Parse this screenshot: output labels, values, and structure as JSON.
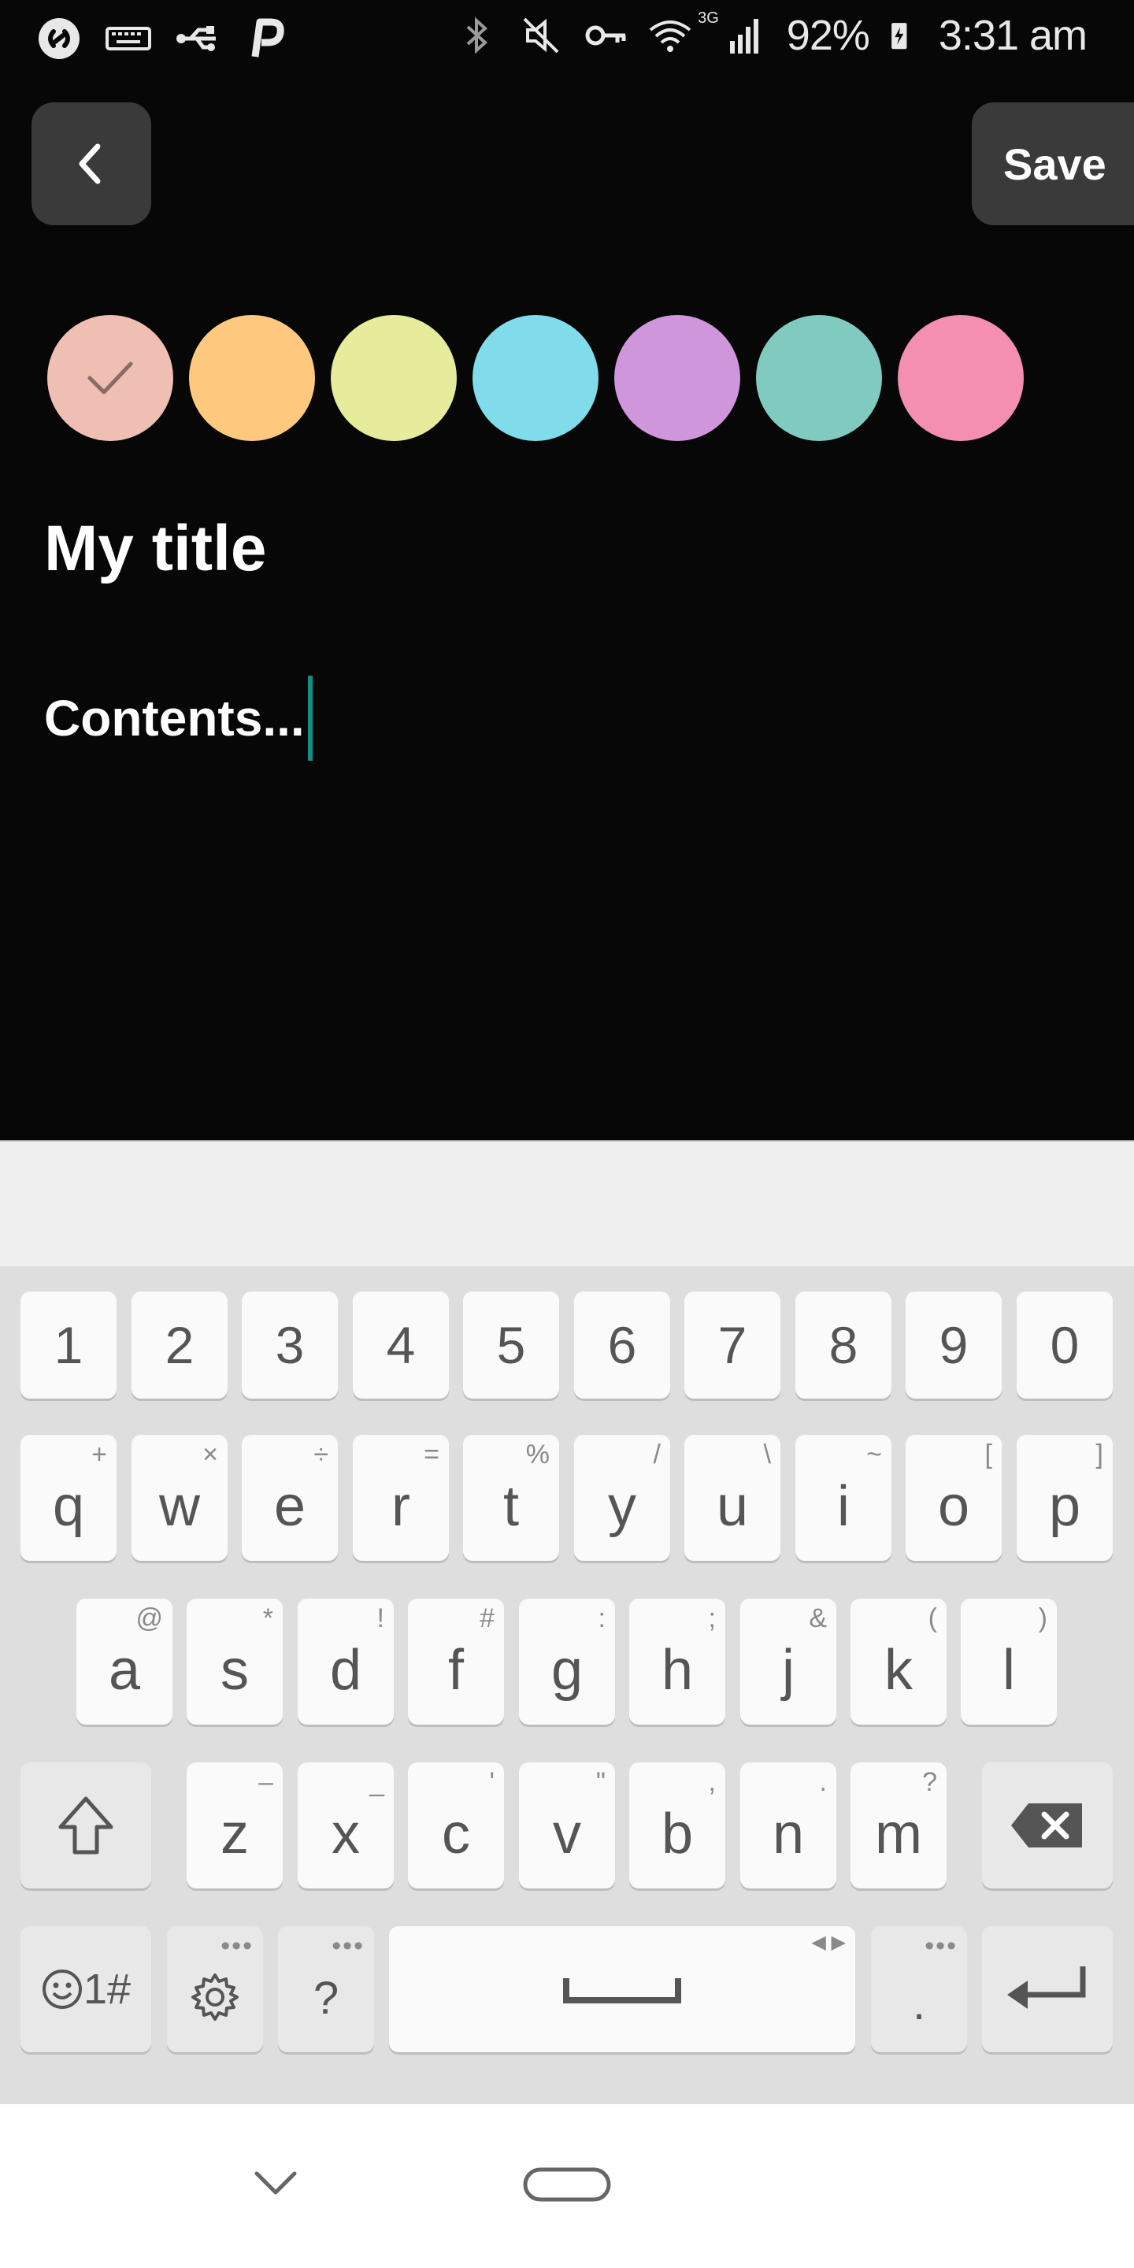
{
  "status_bar": {
    "battery_percent": "92%",
    "time": "3:31 am",
    "network": "3G",
    "icons": [
      "shazam-icon",
      "keyboard-icon",
      "usb-icon",
      "parking-icon",
      "bluetooth-icon",
      "mute-icon",
      "vpn-key-icon",
      "wifi-icon",
      "signal-icon",
      "battery-charging-icon"
    ]
  },
  "toolbar": {
    "back_icon": "chevron-left-icon",
    "save_label": "Save"
  },
  "colors": {
    "selected": "#f0bfb3",
    "swatches": [
      "#f0bfb3",
      "#fec97f",
      "#e7eb9c",
      "#80dcea",
      "#cf96dc",
      "#80cac0",
      "#f48fb1"
    ]
  },
  "note": {
    "title": "My title",
    "content": "Contents..."
  },
  "keyboard": {
    "number_row": [
      "1",
      "2",
      "3",
      "4",
      "5",
      "6",
      "7",
      "8",
      "9",
      "0"
    ],
    "row1": [
      {
        "key": "q",
        "hint": "+"
      },
      {
        "key": "w",
        "hint": "×"
      },
      {
        "key": "e",
        "hint": "÷"
      },
      {
        "key": "r",
        "hint": "="
      },
      {
        "key": "t",
        "hint": "%"
      },
      {
        "key": "y",
        "hint": "/"
      },
      {
        "key": "u",
        "hint": "\\"
      },
      {
        "key": "i",
        "hint": "~"
      },
      {
        "key": "o",
        "hint": "["
      },
      {
        "key": "p",
        "hint": "]"
      }
    ],
    "row2": [
      {
        "key": "a",
        "hint": "@"
      },
      {
        "key": "s",
        "hint": "*"
      },
      {
        "key": "d",
        "hint": "!"
      },
      {
        "key": "f",
        "hint": "#"
      },
      {
        "key": "g",
        "hint": ":"
      },
      {
        "key": "h",
        "hint": ";"
      },
      {
        "key": "j",
        "hint": "&"
      },
      {
        "key": "k",
        "hint": "("
      },
      {
        "key": "l",
        "hint": ")"
      }
    ],
    "row3": [
      {
        "key": "z",
        "hint": "–"
      },
      {
        "key": "x",
        "hint": "_"
      },
      {
        "key": "c",
        "hint": "'"
      },
      {
        "key": "v",
        "hint": "\""
      },
      {
        "key": "b",
        "hint": ","
      },
      {
        "key": "n",
        "hint": "."
      },
      {
        "key": "m",
        "hint": "?"
      }
    ],
    "symbols_label": "1#",
    "question_label": "?",
    "period_label": ".",
    "icons": [
      "shift-icon",
      "backspace-icon",
      "emoji-icon",
      "settings-icon",
      "space-icon",
      "enter-icon"
    ]
  },
  "nav_bar": {
    "icons": [
      "hide-keyboard-icon",
      "home-icon"
    ]
  }
}
